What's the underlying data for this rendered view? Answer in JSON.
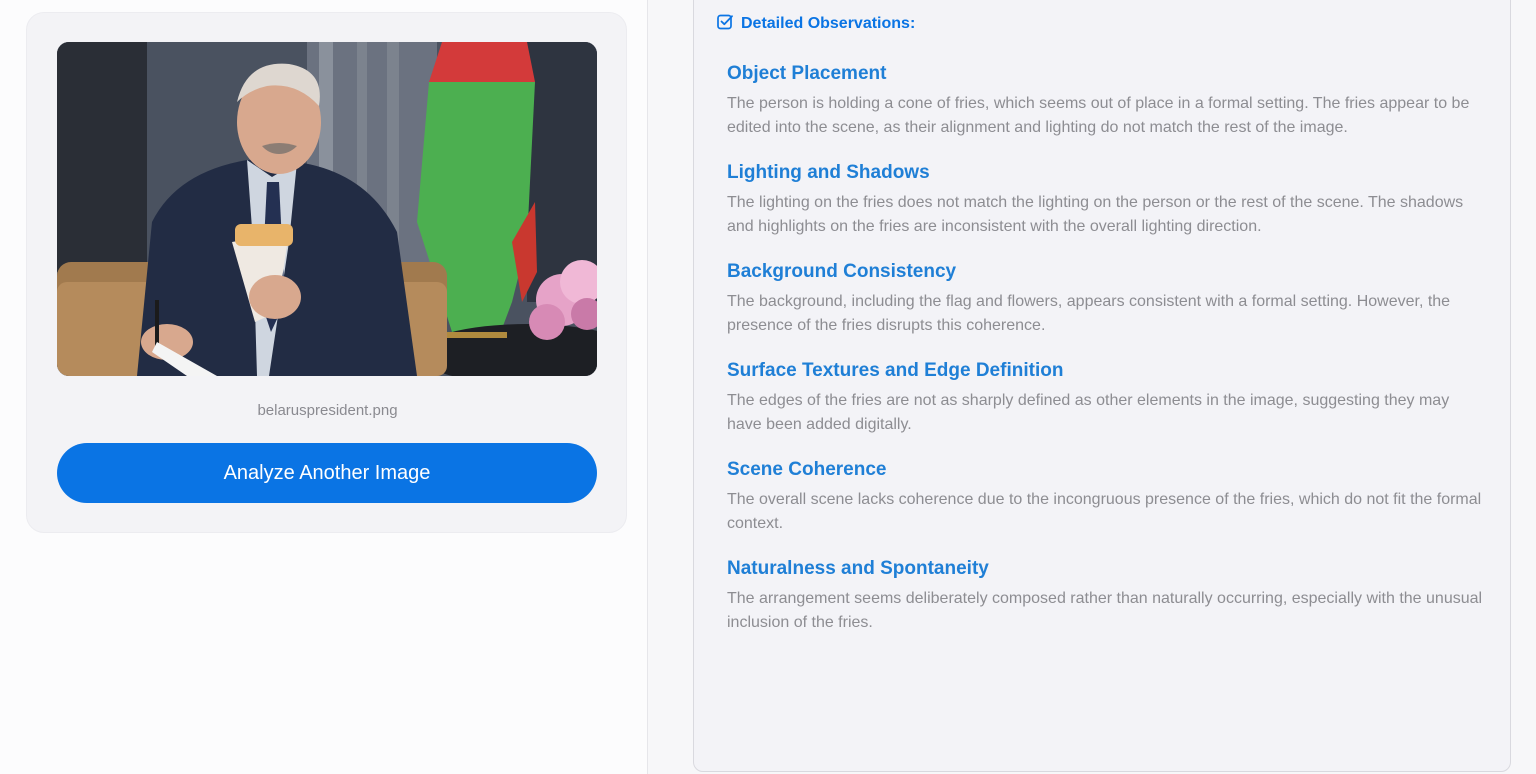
{
  "upload": {
    "filename": "belaruspresident.png",
    "analyze_another_label": "Analyze Another Image"
  },
  "observations": {
    "header_label": "Detailed Observations:",
    "items": [
      {
        "title": "Object Placement",
        "text": "The person is holding a cone of fries, which seems out of place in a formal setting. The fries appear to be edited into the scene, as their alignment and lighting do not match the rest of the image."
      },
      {
        "title": "Lighting and Shadows",
        "text": "The lighting on the fries does not match the lighting on the person or the rest of the scene. The shadows and highlights on the fries are inconsistent with the overall lighting direction."
      },
      {
        "title": "Background Consistency",
        "text": "The background, including the flag and flowers, appears consistent with a formal setting. However, the presence of the fries disrupts this coherence."
      },
      {
        "title": "Surface Textures and Edge Definition",
        "text": "The edges of the fries are not as sharply defined as other elements in the image, suggesting they may have been added digitally."
      },
      {
        "title": "Scene Coherence",
        "text": "The overall scene lacks coherence due to the incongruous presence of the fries, which do not fit the formal context."
      },
      {
        "title": "Naturalness and Spontaneity",
        "text": "The arrangement seems deliberately composed rather than naturally occurring, especially with the unusual inclusion of the fries."
      }
    ]
  },
  "colors": {
    "accent": "#0a74e4",
    "title_blue": "#1f7fd6",
    "body_text": "#8d8d92"
  },
  "icons": {
    "header": "checkbox-icon"
  }
}
